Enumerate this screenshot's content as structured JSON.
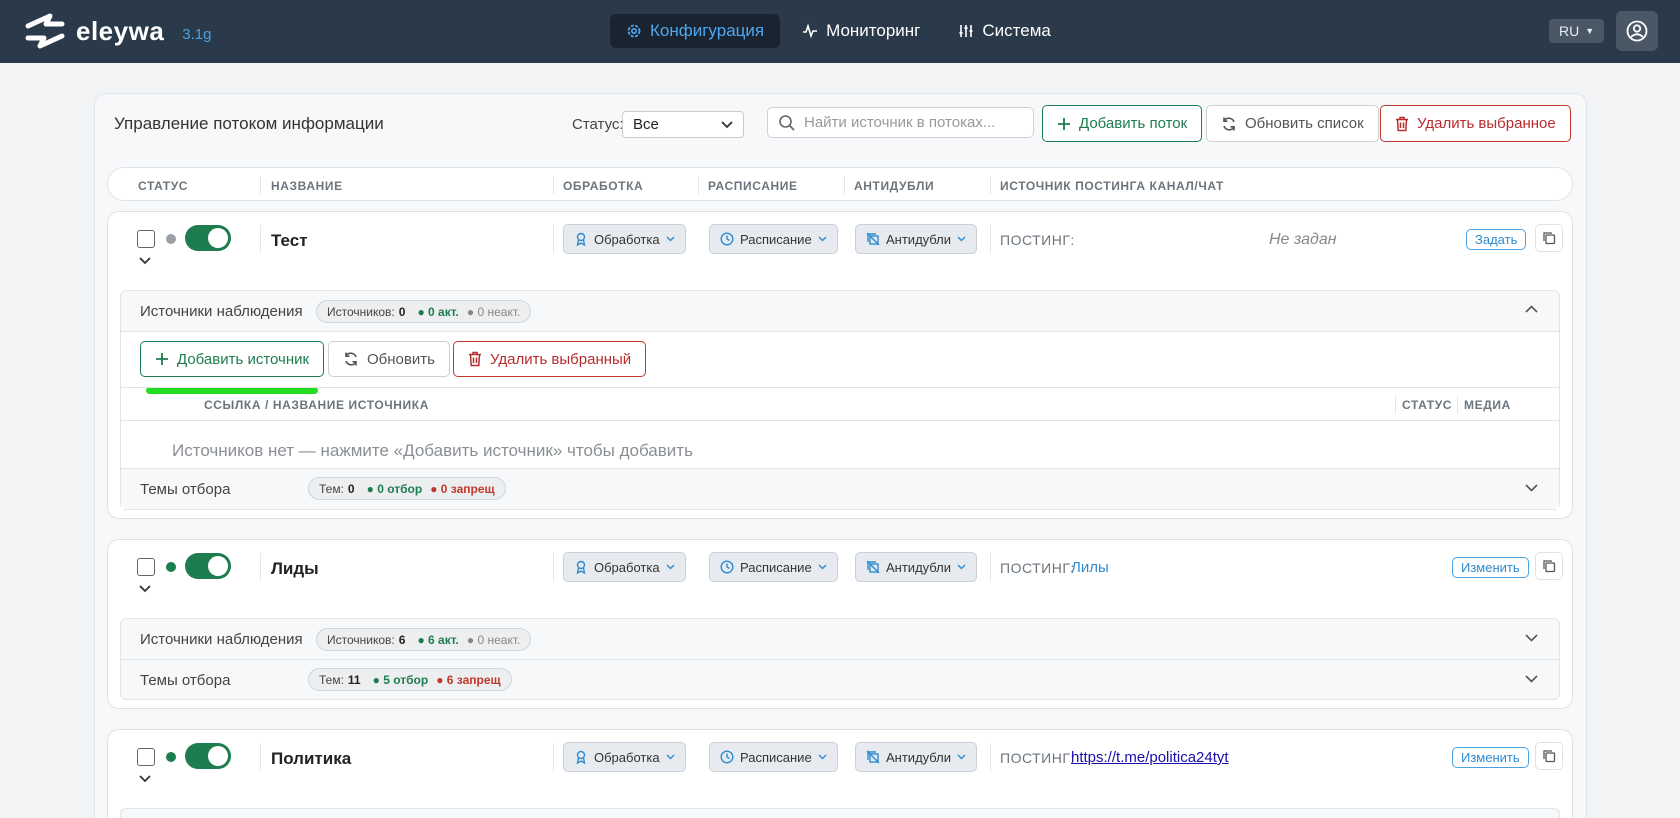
{
  "app": {
    "name": "eleywa",
    "version": "3.1g"
  },
  "nav": {
    "items": [
      {
        "label": "Конфигурация"
      },
      {
        "label": "Мониторинг"
      },
      {
        "label": "Система"
      }
    ],
    "lang": "RU"
  },
  "toolbar": {
    "title": "Управление потоком информации",
    "status_label": "Статус:",
    "status_value": "Все",
    "search_placeholder": "Найти источник в потоках...",
    "add_stream": "Добавить поток",
    "refresh_list": "Обновить список",
    "delete_selected": "Удалить выбранное"
  },
  "table": {
    "headers": [
      "СТАТУС",
      "НАЗВАНИЕ",
      "ОБРАБОТКА",
      "РАСПИСАНИЕ",
      "АНТИДУБЛИ",
      "ИСТОЧНИК ПОСТИНГА КАНАЛ/ЧАТ"
    ]
  },
  "pills": {
    "processing": "Обработка",
    "schedule": "Расписание",
    "antidup": "Антидубли"
  },
  "posting_label": "ПОСТИНГ:",
  "streams": [
    {
      "name": "Тест",
      "status_color": "#9aa0a6",
      "posting_value": "Не задан",
      "action": "Задать",
      "sources": {
        "title": "Источники наблюдения",
        "count_label": "Источников:",
        "count": "0",
        "active": "● 0 акт.",
        "inactive": "● 0 неакт.",
        "add_source": "Добавить источник",
        "refresh": "Обновить",
        "delete_selected": "Удалить выбранный",
        "col_link": "ССЫЛКА / НАЗВАНИЕ ИСТОЧНИКА",
        "col_status": "СТАТУС",
        "col_media": "МЕДИА",
        "empty": "Источников нет — нажмите «Добавить источник» чтобы добавить"
      },
      "topics": {
        "title": "Темы отбора",
        "count_label": "Тем:",
        "count": "0",
        "selected": "● 0 отбор",
        "banned": "● 0 запрещ"
      }
    },
    {
      "name": "Лиды",
      "status_color": "#1e7d4f",
      "posting_value": "Лилы",
      "action": "Изменить",
      "sources": {
        "title": "Источники наблюдения",
        "count_label": "Источников:",
        "count": "6",
        "active": "● 6 акт.",
        "inactive": "● 0 неакт."
      },
      "topics": {
        "title": "Темы отбора",
        "count_label": "Тем:",
        "count": "11",
        "selected": "● 5 отбор",
        "banned": "● 6 запрещ"
      }
    },
    {
      "name": "Политика",
      "status_color": "#1e7d4f",
      "posting_value": "https://t.me/politica24tyt",
      "action": "Изменить"
    }
  ],
  "colors": {
    "nav_bg": "#2b3a4a",
    "accent_blue": "#4ea8ef",
    "green": "#1e7d4f",
    "red": "#c0392b",
    "highlight": "#22dd22"
  }
}
